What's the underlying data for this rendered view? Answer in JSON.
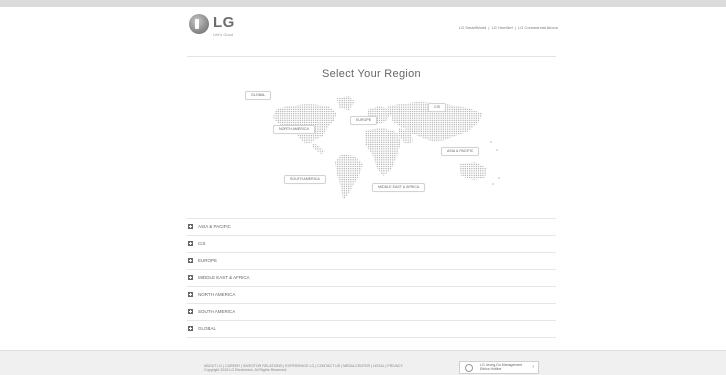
{
  "header": {
    "logo_text": "LG",
    "logo_tagline": "Life's Good",
    "links": [
      "LG SmartWorld",
      "LG HomNet",
      "LG Commercial Aircon"
    ],
    "link_separator": "|"
  },
  "main": {
    "title": "Select Your Region",
    "map_labels": {
      "global": "GLOBAL",
      "cis": "CIS",
      "europe": "EUROPE",
      "north_america": "NORTH AMERICA",
      "asia_pacific": "ASIA & PACIFIC",
      "south_america": "SOUTH AMERICA",
      "middle_east_africa": "MIDDLE EAST & AFRICA"
    },
    "region_list": [
      "ASIA & PACIFIC",
      "CIS",
      "EUROPE",
      "MIDDLE EAST & AFRICA",
      "NORTH AMERICA",
      "SOUTH AMERICA",
      "GLOBAL"
    ]
  },
  "footer": {
    "links_line": "ABOUT LG | CAREER | INVESTOR RELATIONS | EXPERIENCE LG | CONTACT US | MEDIA CENTER | LEGAL | PRIVACY",
    "copyright": "Copyright 2015 LG Electronics. All Rights Reserved.",
    "ethics_line1": "LG Jeong-Do Management",
    "ethics_line2": "Ethics Hotline"
  }
}
